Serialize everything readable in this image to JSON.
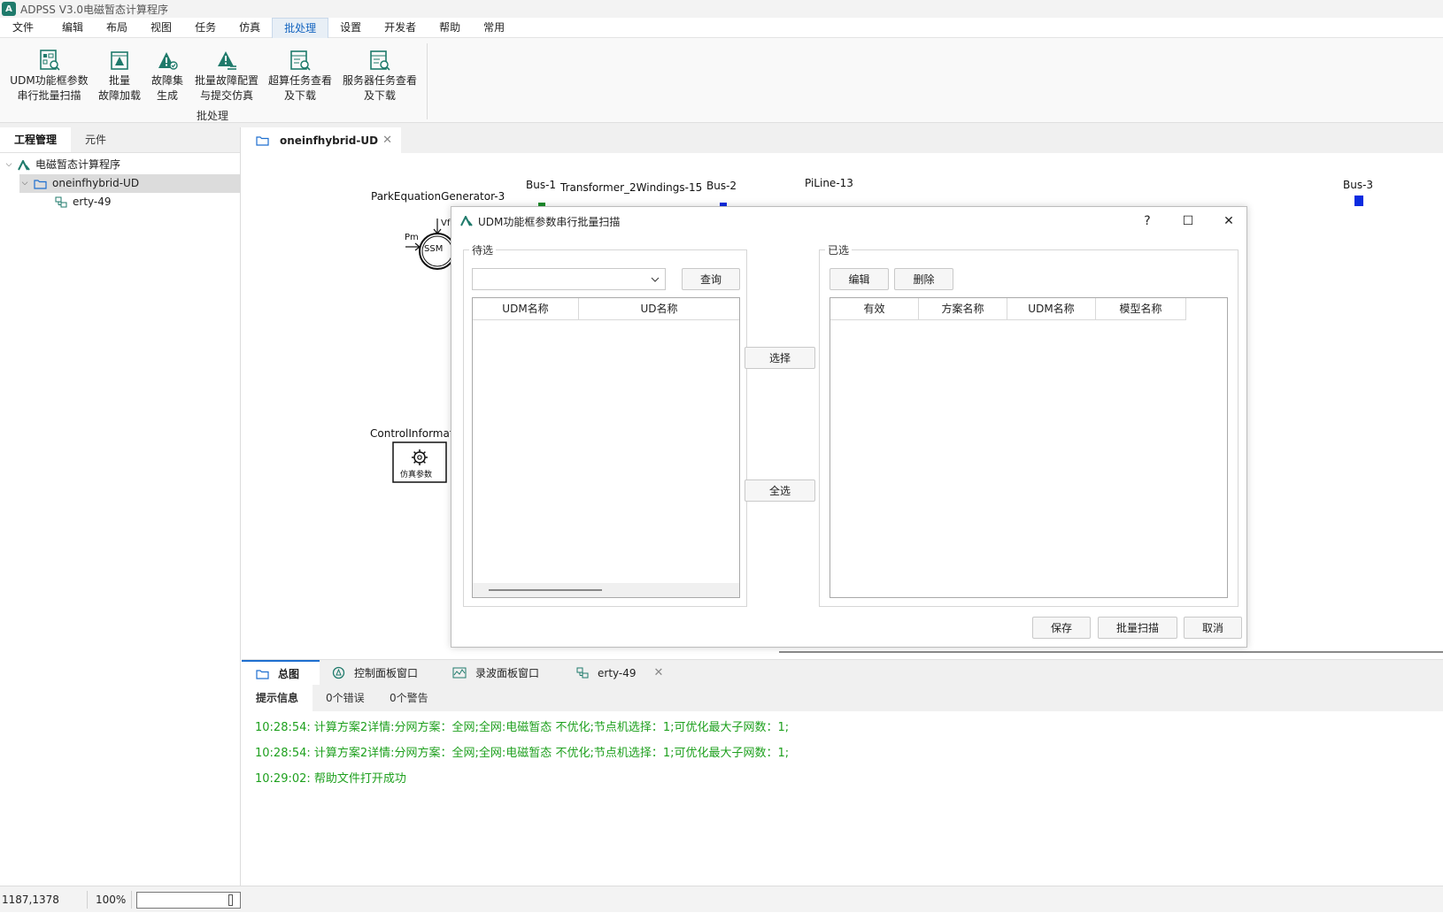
{
  "app": {
    "title": "ADPSS V3.0电磁暂态计算程序",
    "logo_text": "A"
  },
  "menu": [
    "文件",
    "编辑",
    "布局",
    "视图",
    "任务",
    "仿真",
    "批处理",
    "设置",
    "开发者",
    "帮助",
    "常用"
  ],
  "ribbon": {
    "buttons": [
      {
        "line1": "UDM功能框参数",
        "line2": "串行批量扫描"
      },
      {
        "line1": "批量",
        "line2": "故障加载"
      },
      {
        "line1": "故障集",
        "line2": "生成"
      },
      {
        "line1": "批量故障配置",
        "line2": "与提交仿真"
      },
      {
        "line1": "超算任务查看",
        "line2": "及下载"
      },
      {
        "line1": "服务器任务查看",
        "line2": "及下载"
      }
    ],
    "group_label": "批处理"
  },
  "left_panel": {
    "tabs": [
      "工程管理",
      "元件"
    ],
    "tree": [
      "电磁暂态计算程序",
      "oneinfhybrid-UD",
      "erty-49"
    ]
  },
  "doc_tab": {
    "label": "oneinfhybrid-UD",
    "close": "✕"
  },
  "canvas": {
    "labels": {
      "generator": "ParkEquationGenerator-3",
      "bus1": "Bus-1",
      "transformer": "Transformer_2Windings-15",
      "bus2": "Bus-2",
      "piline": "PiLine-13",
      "bus3": "Bus-3",
      "control": "ControlInformat",
      "ssm": "SSM",
      "pm": "Pm",
      "vf": "Vf",
      "sim_params": "仿真参数"
    }
  },
  "dialog": {
    "title": "UDM功能框参数串行批量扫描",
    "help": "?",
    "maximize": "☐",
    "close": "✕",
    "pending": {
      "title": "待选",
      "combo_value": "",
      "query_btn": "查询",
      "columns": [
        "UDM名称",
        "UD名称"
      ]
    },
    "select_btn": "选择",
    "select_all_btn": "全选",
    "selected": {
      "title": "已选",
      "edit_btn": "编辑",
      "delete_btn": "删除",
      "columns": [
        "有效",
        "方案名称",
        "UDM名称",
        "模型名称"
      ]
    },
    "save_btn": "保存",
    "batch_btn": "批量扫描",
    "cancel_btn": "取消"
  },
  "bottom_tabs": [
    "总图",
    "控制面板窗口",
    "录波面板窗口",
    "erty-49"
  ],
  "message_tabs": [
    "提示信息",
    "0个错误",
    "0个警告"
  ],
  "messages": [
    "10:28:54: 计算方案2详情:分网方案：全网;全网:电磁暂态 不优化;节点机选择：1;可优化最大子网数：1;",
    "10:28:54: 计算方案2详情:分网方案：全网;全网:电磁暂态 不优化;节点机选择：1;可优化最大子网数：1;",
    "10:29:02: 帮助文件打开成功"
  ],
  "status": {
    "coords": "1187,1378",
    "zoom": "100%"
  },
  "colors": {
    "accent": "#1e6fd0",
    "message_green": "#1ea01e",
    "logo": "#1f7a6b",
    "bus_blue": "#0a2be0",
    "bus_green": "#1a8c2a"
  }
}
